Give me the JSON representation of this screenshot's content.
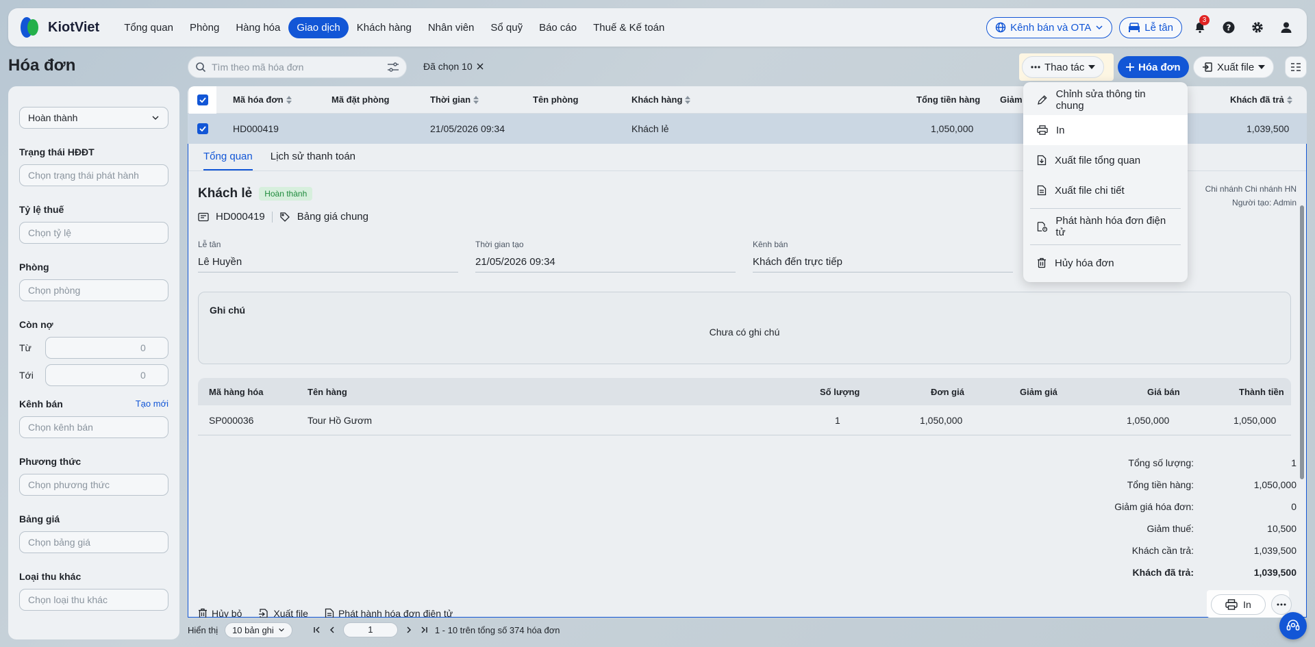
{
  "nav": {
    "logo": "KiotViet",
    "items": [
      "Tổng quan",
      "Phòng",
      "Hàng hóa",
      "Giao dịch",
      "Khách hàng",
      "Nhân viên",
      "Sổ quỹ",
      "Báo cáo",
      "Thuế & Kế toán"
    ],
    "active_index": 3,
    "channel_label": "Kênh bán và OTA",
    "reception_label": "Lễ tân",
    "notif_count": "3"
  },
  "toolbar": {
    "page_title": "Hóa đơn",
    "search_placeholder": "Tìm theo mã hóa đơn",
    "selected_label": "Đã chọn 10",
    "actions_label": "Thao tác",
    "new_invoice_label": "Hóa đơn",
    "export_label": "Xuất file"
  },
  "sidebar": {
    "status_value": "Hoàn thành",
    "einvoice_label": "Trạng thái HĐĐT",
    "einvoice_placeholder": "Chọn trạng thái phát hành",
    "tax_label": "Tỷ lệ thuế",
    "tax_placeholder": "Chọn tỷ lệ",
    "room_label": "Phòng",
    "room_placeholder": "Chọn phòng",
    "debt_label": "Còn nợ",
    "from_label": "Từ",
    "from_value": "0",
    "to_label": "Tới",
    "to_value": "0",
    "channel_label": "Kênh bán",
    "channel_create": "Tạo mới",
    "channel_placeholder": "Chọn kênh bán",
    "method_label": "Phương thức",
    "method_placeholder": "Chọn phương thức",
    "pricebook_label": "Bảng giá",
    "pricebook_placeholder": "Chọn bảng giá",
    "other_label": "Loại thu khác",
    "other_placeholder": "Chọn loại thu khác"
  },
  "table": {
    "headers": {
      "code": "Mã hóa đơn",
      "booking": "Mã đặt phòng",
      "time": "Thời gian",
      "room": "Tên phòng",
      "customer": "Khách hàng",
      "total": "Tổng tiền hàng",
      "discount": "Giảm",
      "paid": "Khách đã trả"
    },
    "row": {
      "code": "HD000419",
      "time": "21/05/2026 09:34",
      "customer": "Khách lẻ",
      "total": "1,050,000",
      "paid": "1,039,500"
    }
  },
  "detail": {
    "tabs": [
      "Tổng quan",
      "Lịch sử thanh toán"
    ],
    "customer": "Khách lẻ",
    "status": "Hoàn thành",
    "code": "HD000419",
    "pricebook": "Bảng giá chung",
    "branch": "Chi nhánh Chi nhánh HN",
    "creator": "Người tạo: Admin",
    "fields": [
      {
        "label": "Lễ tân",
        "value": "Lê Huyền"
      },
      {
        "label": "Thời gian tạo",
        "value": "21/05/2026 09:34"
      },
      {
        "label": "Kênh bán",
        "value": "Khách đến trực tiếp"
      }
    ],
    "note_title": "Ghi chú",
    "note_empty": "Chưa có ghi chú",
    "items_headers": {
      "code": "Mã hàng hóa",
      "name": "Tên hàng",
      "qty": "Số lượng",
      "price": "Đơn giá",
      "discount": "Giảm giá",
      "sale": "Giá bán",
      "amount": "Thành tiền"
    },
    "item": {
      "code": "SP000036",
      "name": "Tour Hồ Gươm",
      "qty": "1",
      "price": "1,050,000",
      "sale": "1,050,000",
      "amount": "1,050,000"
    },
    "totals": [
      {
        "label": "Tổng số lượng:",
        "value": "1"
      },
      {
        "label": "Tổng tiền hàng:",
        "value": "1,050,000"
      },
      {
        "label": "Giảm giá hóa đơn:",
        "value": "0"
      },
      {
        "label": "Giảm thuế:",
        "value": "10,500"
      },
      {
        "label": "Khách cần trả:",
        "value": "1,039,500"
      },
      {
        "label": "Khách đã trả:",
        "value": "1,039,500"
      }
    ],
    "actions": {
      "cancel": "Hủy bỏ",
      "export": "Xuất file",
      "einvoice": "Phát hành hóa đơn điện tử",
      "print": "In"
    }
  },
  "pager": {
    "show_label": "Hiển thị",
    "page_size": "10 bản ghi",
    "page": "1",
    "summary": "1 - 10 trên tổng số 374 hóa đơn"
  },
  "dropdown": {
    "items": [
      {
        "label": "Chỉnh sửa thông tin chung",
        "icon": "pencil-icon"
      },
      {
        "label": "In",
        "icon": "printer-icon"
      },
      {
        "label": "Xuất file tổng quan",
        "icon": "file-export-icon"
      },
      {
        "label": "Xuất file chi tiết",
        "icon": "file-detail-icon"
      },
      {
        "label": "Phát hành hóa đơn điện tử",
        "icon": "einvoice-icon"
      },
      {
        "label": "Hủy hóa đơn",
        "icon": "trash-icon"
      }
    ]
  },
  "colors": {
    "primary": "#1256d6",
    "success_bg": "#d7efdd",
    "success_text": "#1e8a3c",
    "danger": "#e02424"
  }
}
